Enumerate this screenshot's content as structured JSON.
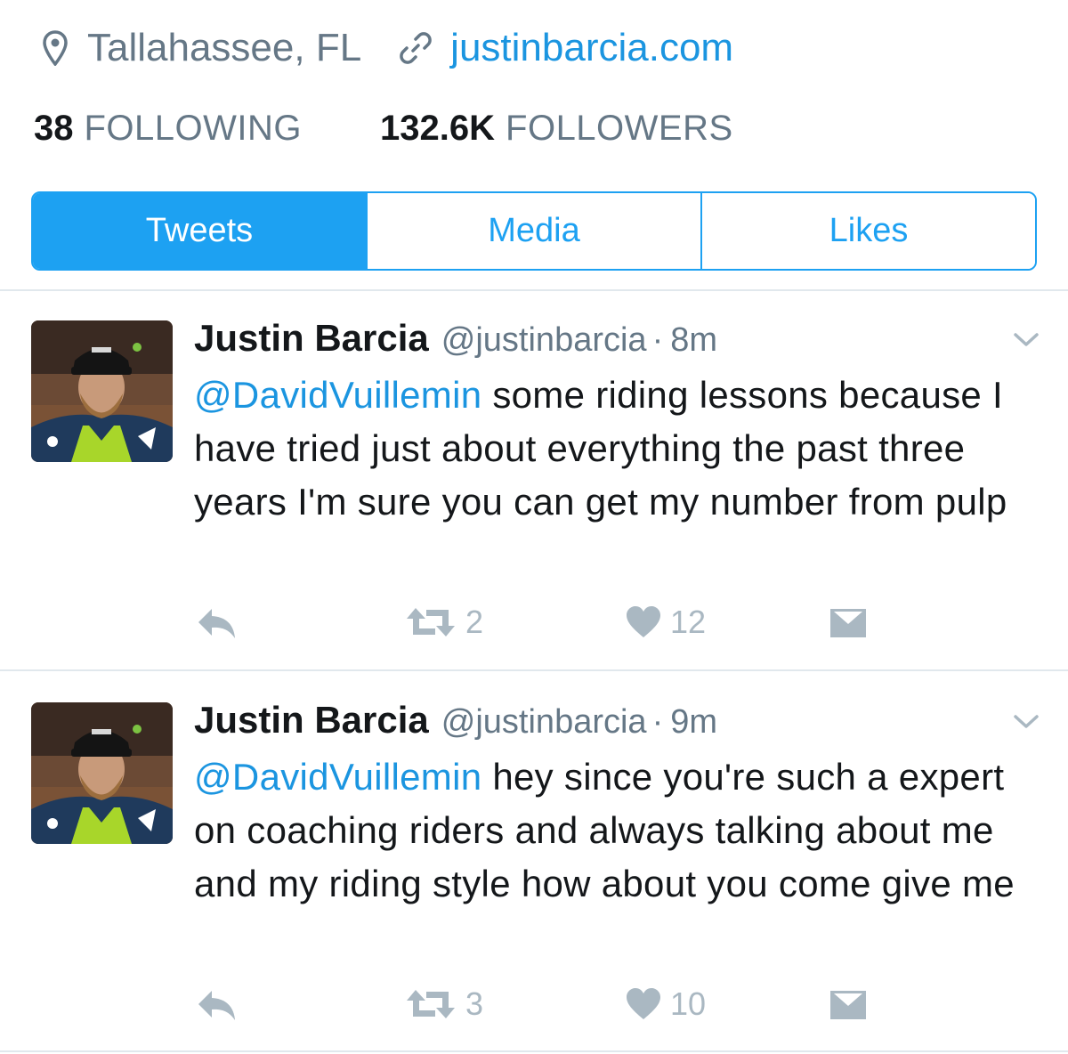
{
  "profile": {
    "location": "Tallahassee, FL",
    "website": "justinbarcia.com",
    "following_count": "38",
    "following_label": "FOLLOWING",
    "followers_count": "132.6K",
    "followers_label": "FOLLOWERS"
  },
  "tabs": [
    {
      "label": "Tweets",
      "active": true
    },
    {
      "label": "Media",
      "active": false
    },
    {
      "label": "Likes",
      "active": false
    }
  ],
  "tweets": [
    {
      "name": "Justin Barcia",
      "handle": "@justinbarcia",
      "separator": "·",
      "time": "8m",
      "mention": "@DavidVuillemin",
      "text": " some riding lessons because I have tried just about everything the past three years I'm sure you can get my number from pulp",
      "retweets": "2",
      "likes": "12"
    },
    {
      "name": "Justin Barcia",
      "handle": "@justinbarcia",
      "separator": "·",
      "time": "9m",
      "mention": "@DavidVuillemin",
      "text": " hey since you're such a expert on coaching riders and always talking about me and my riding style how about you come give me",
      "retweets": "3",
      "likes": "10"
    }
  ],
  "colors": {
    "accent": "#1da1f2",
    "link": "#1b95e0",
    "secondary_text": "#657786",
    "action_icon": "#aab8c2",
    "divider": "#e1e8ed"
  },
  "icons": {
    "location": "map-pin-icon",
    "website": "link-icon",
    "more": "chevron-down-icon",
    "reply": "reply-icon",
    "retweet": "retweet-icon",
    "like": "heart-icon",
    "dm": "envelope-icon"
  }
}
